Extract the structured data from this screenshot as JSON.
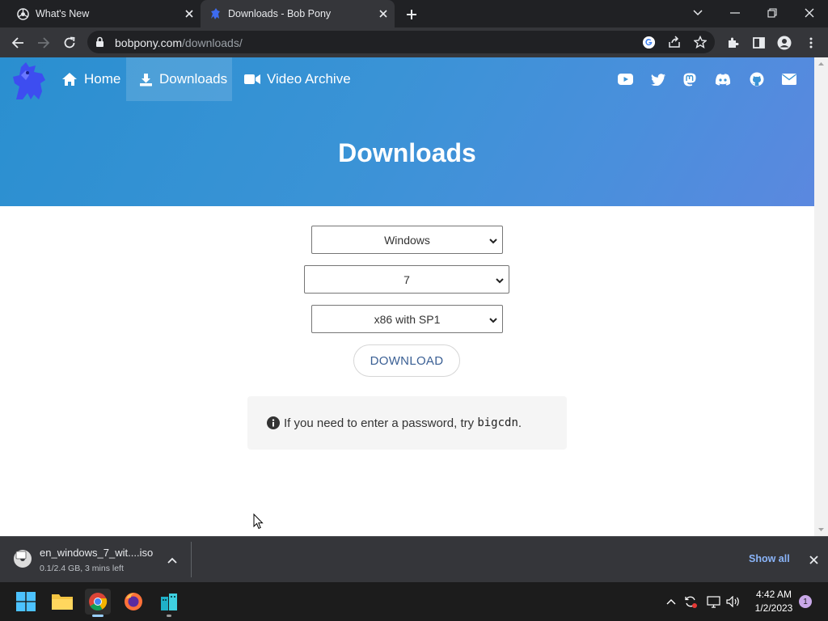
{
  "browser": {
    "tabs": [
      {
        "title": "What's New"
      },
      {
        "title": "Downloads - Bob Pony"
      }
    ],
    "url_host": "bobpony.com",
    "url_path": "/downloads/"
  },
  "site": {
    "nav": [
      {
        "label": "Home"
      },
      {
        "label": "Downloads"
      },
      {
        "label": "Video Archive"
      }
    ],
    "social_icons": [
      "youtube-icon",
      "twitter-icon",
      "mastodon-icon",
      "discord-icon",
      "github-icon",
      "mail-icon"
    ],
    "hero_title": "Downloads",
    "accent_color": "#3a93d6"
  },
  "form": {
    "os_select": "Windows",
    "version_select": "7",
    "edition_select": "x86 with SP1",
    "download_label": "DOWNLOAD",
    "note_text": "If you need to enter a password, try ",
    "note_code": "bigcdn",
    "note_end": "."
  },
  "download_shelf": {
    "file_name": "en_windows_7_wit....iso",
    "status": "0.1/2.4 GB, 3 mins left",
    "show_all": "Show all"
  },
  "taskbar": {
    "time": "4:42 AM",
    "date": "1/2/2023",
    "notification_count": "1"
  }
}
